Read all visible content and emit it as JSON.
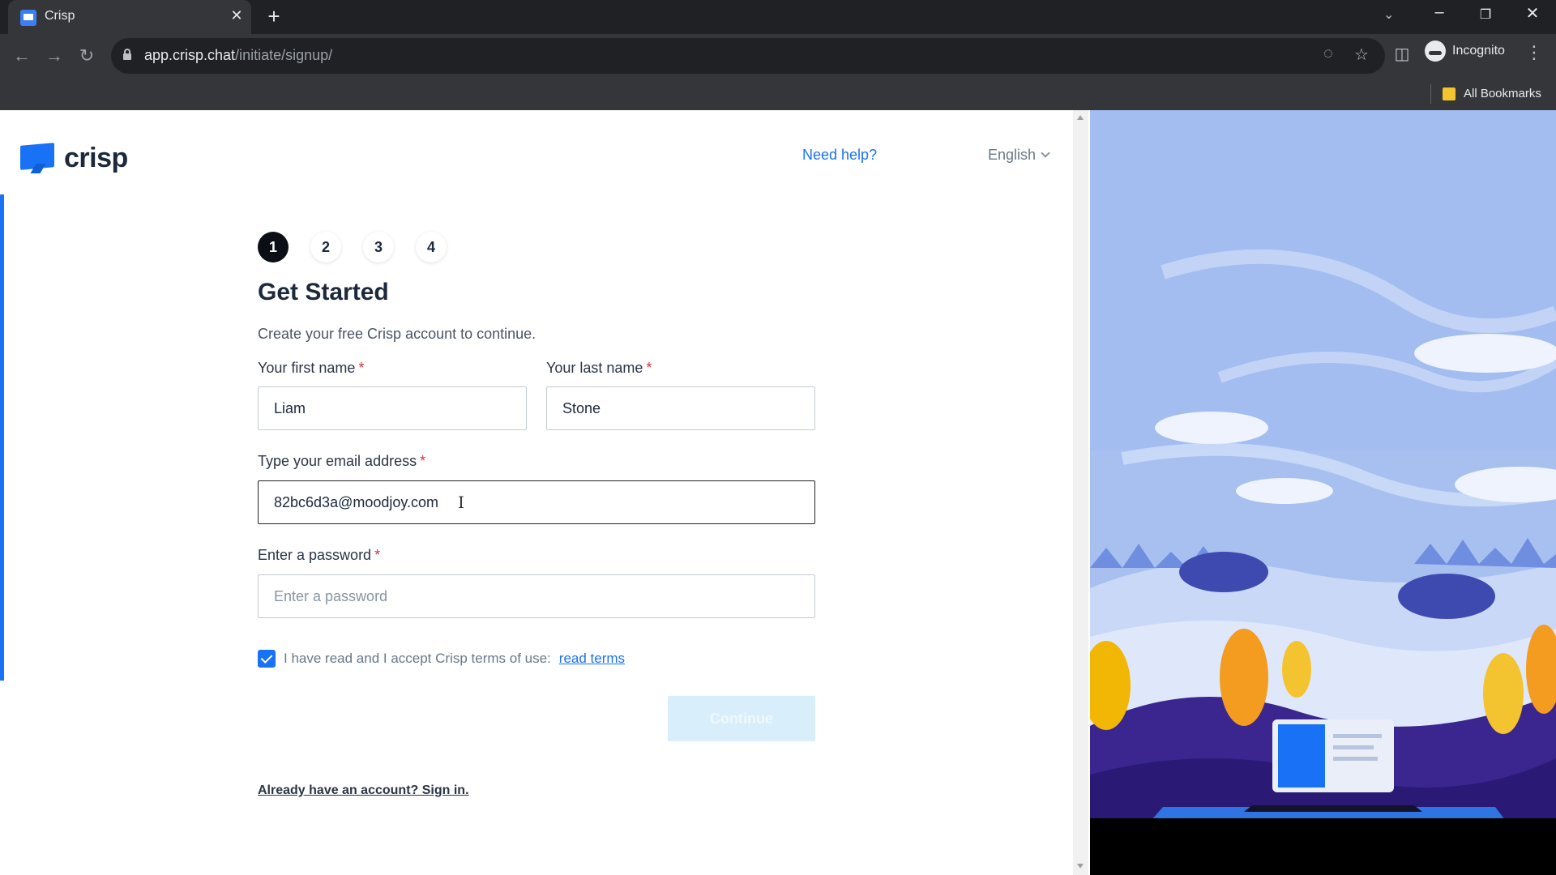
{
  "browser": {
    "tab_title": "Crisp",
    "tab_close": "✕",
    "new_tab": "+",
    "url_domain": "app.crisp.chat",
    "url_path": "/initiate/signup/",
    "profile_label": "Incognito",
    "bookmarks_label": "All Bookmarks",
    "icons": [
      "back-icon",
      "forward-icon",
      "reload-icon",
      "lock-icon",
      "eye-off-icon",
      "star-icon",
      "sidebar-icon",
      "incognito-icon",
      "menu-icon",
      "folder-icon"
    ]
  },
  "header": {
    "logo_text": "crisp",
    "help_link": "Need help?",
    "language": "English"
  },
  "steps": [
    "1",
    "2",
    "3",
    "4"
  ],
  "active_step": 1,
  "form": {
    "heading": "Get Started",
    "subtitle": "Create your free Crisp account to continue.",
    "required_mark": "*",
    "first_name": {
      "label": "Your first name",
      "value": "Liam"
    },
    "last_name": {
      "label": "Your last name",
      "value": "Stone"
    },
    "email": {
      "label": "Type your email address",
      "value": "82bc6d3a@moodjoy.com"
    },
    "password": {
      "label": "Enter a password",
      "placeholder": "Enter a password",
      "value": ""
    },
    "terms_checked": true,
    "terms_text": "I have read and I accept Crisp terms of use:",
    "terms_link": "read terms",
    "continue_label": "Continue",
    "signin_link": "Already have an account? Sign in."
  },
  "colors": {
    "accent": "#1972f5",
    "heading": "#1c293b",
    "required": "#e1303b",
    "button_disabled": "#d8eefb"
  }
}
